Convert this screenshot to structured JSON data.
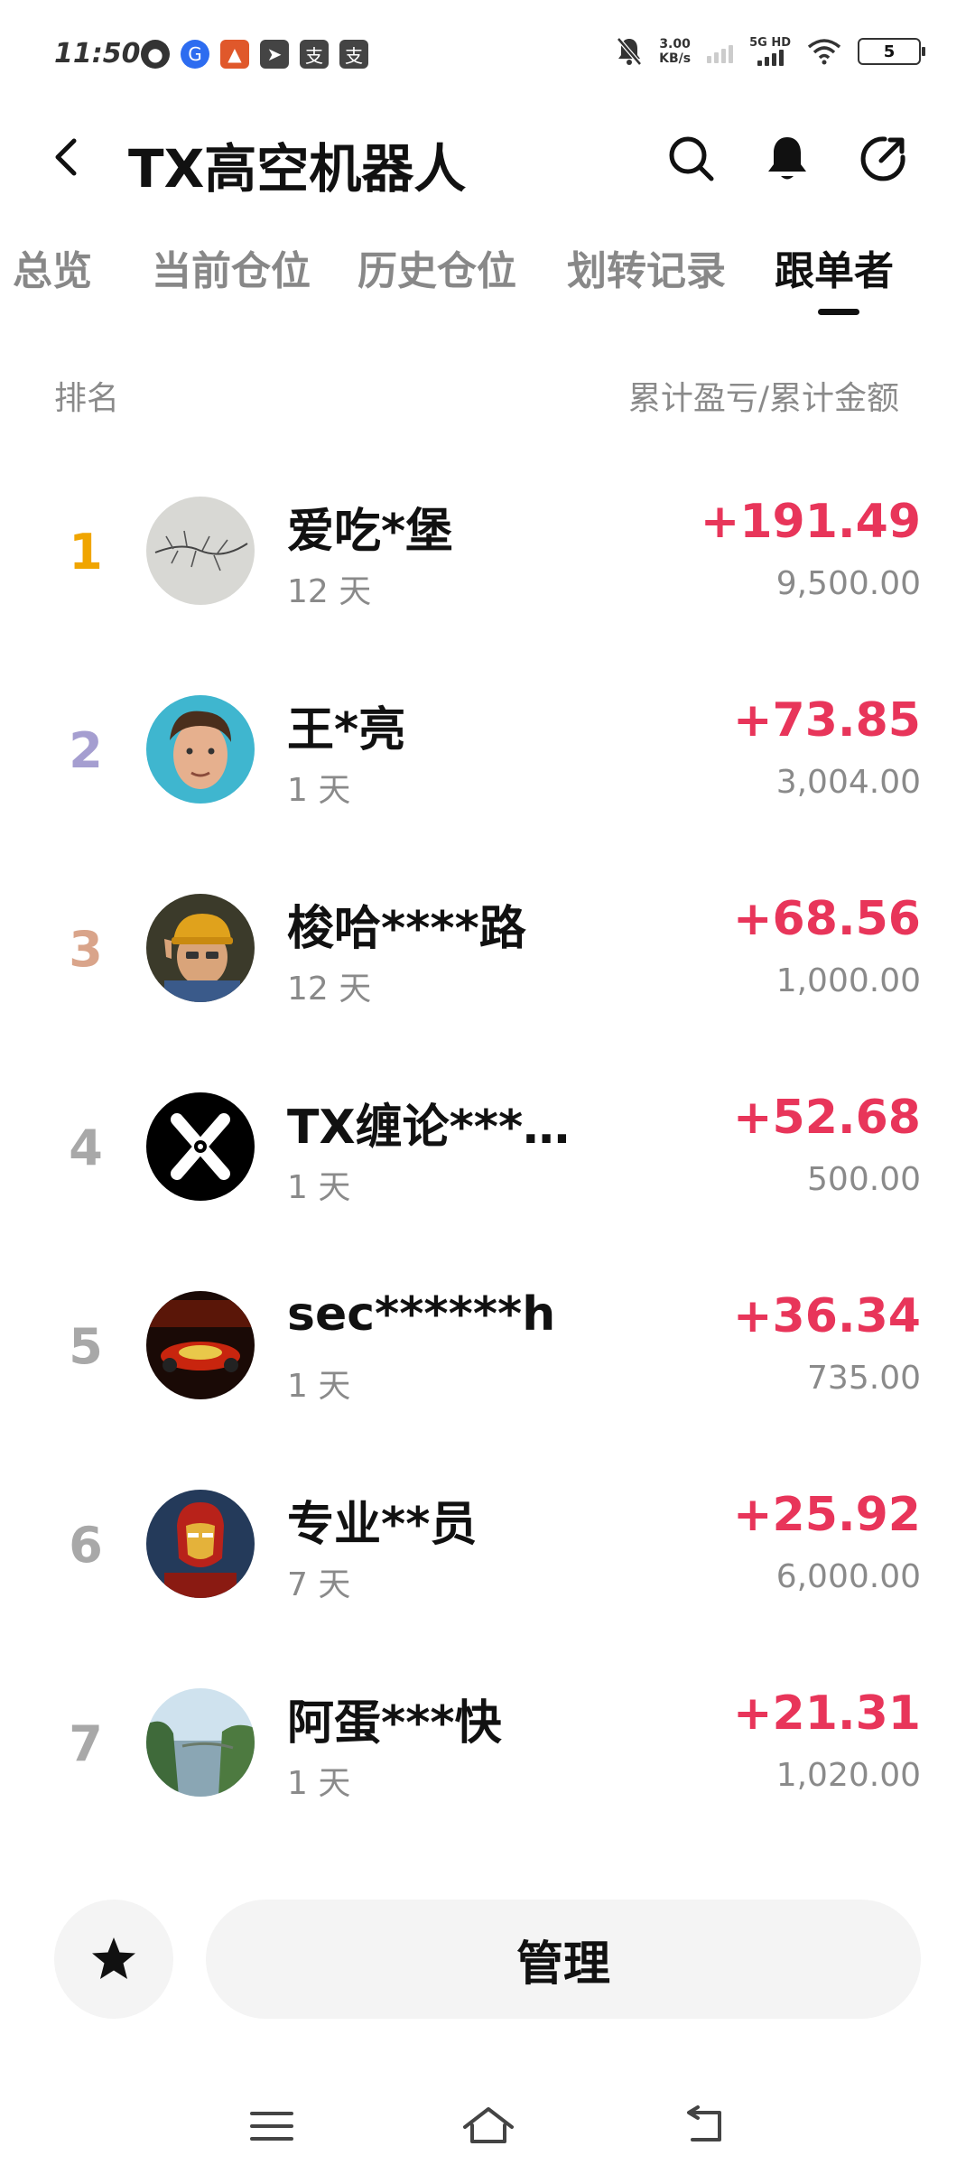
{
  "status_bar": {
    "time": "11:50",
    "net_speed_value": "3.00",
    "net_speed_unit": "KB/s",
    "network_label": "5G HD",
    "battery": "5",
    "left_icons": [
      "qq-icon",
      "app-icon",
      "app-icon",
      "telegram-icon",
      "alipay-icon",
      "alipay-icon"
    ]
  },
  "header": {
    "title": "TX高空机器人"
  },
  "tabs": [
    {
      "label": "总览"
    },
    {
      "label": "当前仓位"
    },
    {
      "label": "历史仓位"
    },
    {
      "label": "划转记录"
    },
    {
      "label": "跟单者"
    }
  ],
  "list_header": {
    "left": "排名",
    "right": "累计盈亏/累计金额"
  },
  "followers": [
    {
      "rank": "1",
      "name": "爱吃*堡",
      "days": "12 天",
      "pnl": "+191.49",
      "amount": "9,500.00"
    },
    {
      "rank": "2",
      "name": "王*亮",
      "days": "1 天",
      "pnl": "+73.85",
      "amount": "3,004.00"
    },
    {
      "rank": "3",
      "name": "梭哈****路",
      "days": "12 天",
      "pnl": "+68.56",
      "amount": "1,000.00"
    },
    {
      "rank": "4",
      "name": "TX缠论****...",
      "days": "1 天",
      "pnl": "+52.68",
      "amount": "500.00"
    },
    {
      "rank": "5",
      "name": "sec******h",
      "days": "1 天",
      "pnl": "+36.34",
      "amount": "735.00"
    },
    {
      "rank": "6",
      "name": "专业**员",
      "days": "7 天",
      "pnl": "+25.92",
      "amount": "6,000.00"
    },
    {
      "rank": "7",
      "name": "阿蛋***快",
      "days": "1 天",
      "pnl": "+21.31",
      "amount": "1,020.00"
    }
  ],
  "rank_colors": {
    "1": "#f0a500",
    "2": "#a59ed0",
    "3": "#d9a48a",
    "other": "#a8a8a8"
  },
  "colors": {
    "profit": "#e8355a",
    "muted": "#8a8a8a"
  },
  "bottom": {
    "manage_label": "管理"
  }
}
